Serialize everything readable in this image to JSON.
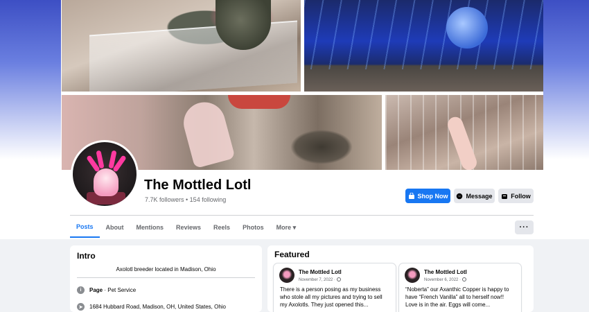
{
  "page": {
    "name": "The Mottled Lotl",
    "stats": "7.7K followers • 154 following"
  },
  "actions": {
    "shop_now": "Shop Now",
    "message": "Message",
    "follow": "Follow",
    "more_dots": "···"
  },
  "tabs": [
    {
      "label": "Posts",
      "active": true
    },
    {
      "label": "About"
    },
    {
      "label": "Mentions"
    },
    {
      "label": "Reviews"
    },
    {
      "label": "Reels"
    },
    {
      "label": "Photos"
    },
    {
      "label": "More ▾"
    }
  ],
  "intro": {
    "title": "Intro",
    "bio": "Axolotl breeder located in Madison, Ohio",
    "category_label": "Page",
    "category_value": "· Pet Service",
    "address": "1684 Hubbard Road, Madison, OH, United States, Ohio"
  },
  "featured": {
    "title": "Featured",
    "posts": [
      {
        "author": "The Mottled Lotl",
        "date": "November 7, 2022 ·",
        "text": "There is a person posing as my business who stole all my pictures and trying to sell my Axolotls. They just opened this..."
      },
      {
        "author": "The Mottled Lotl",
        "date": "November 6, 2022 ·",
        "text": "“Noberta” our Axanthic Copper is happy to have “French Vanilla” all to herself now!! Love is in the air. Eggs will come..."
      }
    ]
  },
  "colors": {
    "accent": "#1877f2",
    "text": "#050505",
    "secondary_text": "#65676b",
    "button_gray": "#e4e6eb"
  }
}
